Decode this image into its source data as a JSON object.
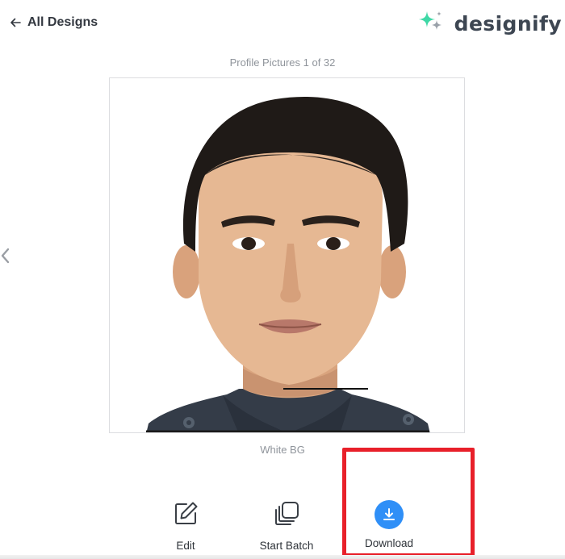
{
  "nav": {
    "back_label": "All Designs",
    "back_icon": "arrow-left-icon"
  },
  "brand": {
    "name": "designify",
    "logo_icon": "sparkle-icon",
    "colors": {
      "sparkle_primary": "#3fd8a6",
      "sparkle_secondary": "#9aa1a9",
      "text": "#3d4652"
    }
  },
  "gallery": {
    "counter": "Profile Pictures 1 of 32",
    "prev_icon": "chevron-left-icon",
    "image_alt": "Profile photo of a man with short dark hair on a white background",
    "caption": "White BG"
  },
  "actions": {
    "edit_label": "Edit",
    "edit_icon": "edit-icon",
    "batch_label": "Start Batch",
    "batch_icon": "stack-icon",
    "download_label": "Download",
    "download_icon": "download-icon",
    "download_color": "#2f8ff7"
  },
  "annotation": {
    "highlight_color": "#e8202a"
  }
}
